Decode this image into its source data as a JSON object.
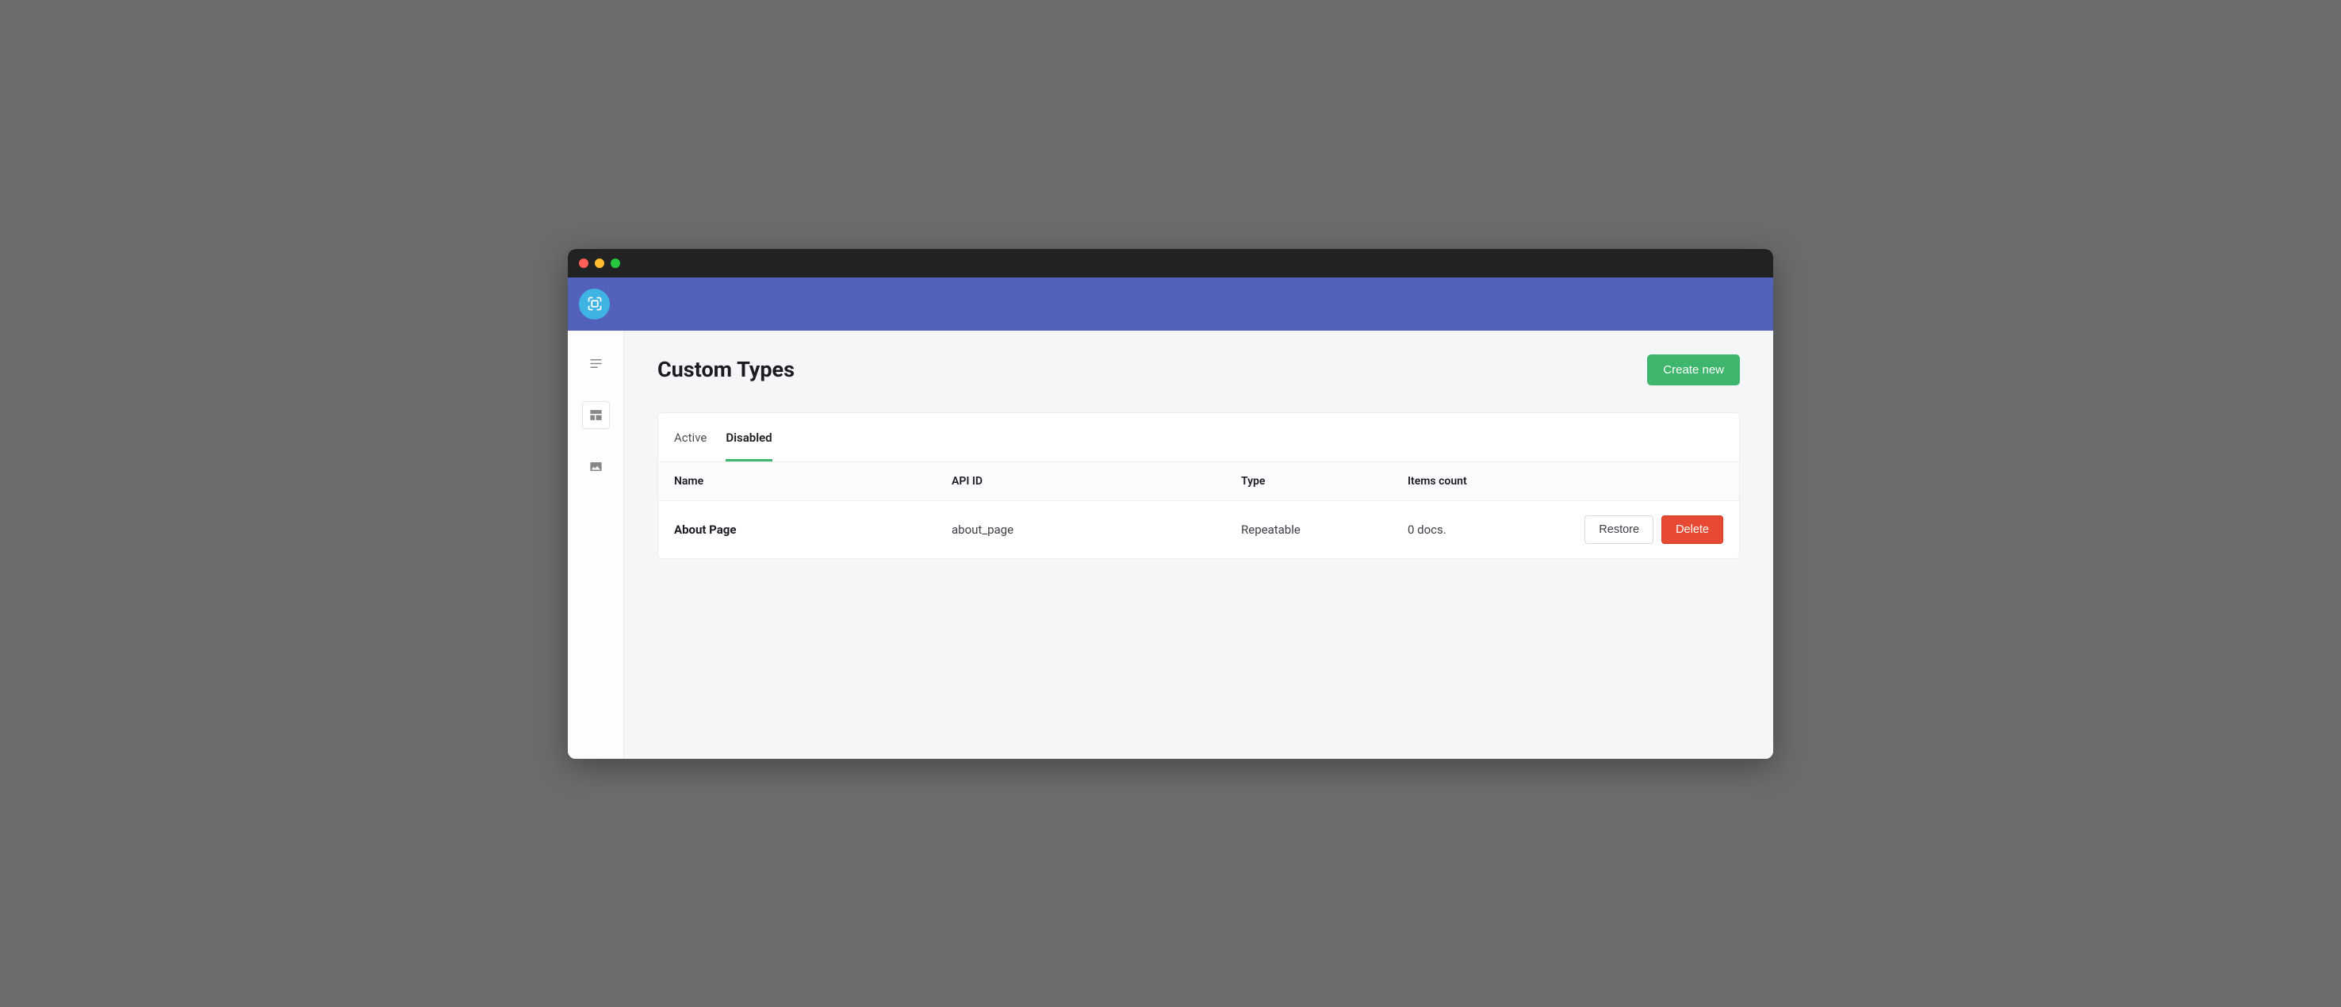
{
  "page": {
    "title": "Custom Types",
    "create_button": "Create new"
  },
  "tabs": {
    "active": "Active",
    "disabled": "Disabled",
    "selected": "disabled"
  },
  "table": {
    "headers": {
      "name": "Name",
      "api_id": "API ID",
      "type": "Type",
      "items_count": "Items count"
    },
    "rows": [
      {
        "name": "About Page",
        "api_id": "about_page",
        "type": "Repeatable",
        "items_count": "0 docs.",
        "restore_label": "Restore",
        "delete_label": "Delete"
      }
    ]
  },
  "sidebar": {
    "items": [
      {
        "name": "documents-icon"
      },
      {
        "name": "layout-icon"
      },
      {
        "name": "image-icon"
      }
    ]
  }
}
